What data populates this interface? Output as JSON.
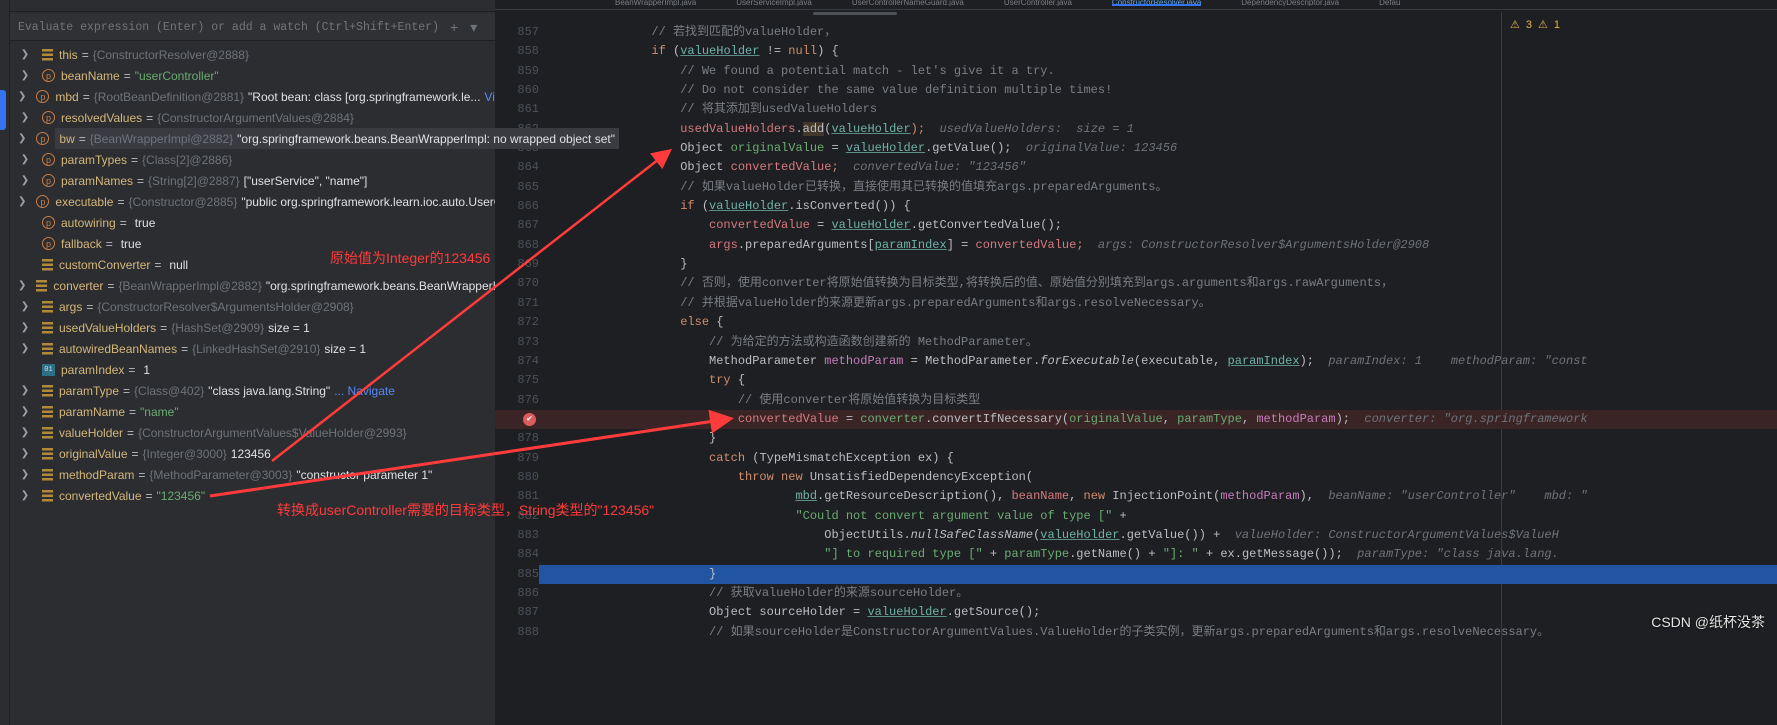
{
  "eval_bar": {
    "placeholder": "Evaluate expression (Enter) or add a watch (Ctrl+Shift+Enter) Java ▴",
    "add_watch_icon": "plus-icon",
    "dropdown_icon": "chevron-down-icon"
  },
  "variables": [
    {
      "arrow": true,
      "icon": "f",
      "name": "this",
      "type": "{ConstructorResolver@2888}"
    },
    {
      "arrow": true,
      "icon": "p",
      "name": "beanName",
      "str": "\"userController\""
    },
    {
      "arrow": true,
      "icon": "p",
      "name": "mbd",
      "type": "{RootBeanDefinition@2881}",
      "value": "\"Root bean: class [org.springframework.le...",
      "link": "View"
    },
    {
      "arrow": true,
      "icon": "p",
      "name": "resolvedValues",
      "type": "{ConstructorArgumentValues@2884}"
    },
    {
      "arrow": true,
      "icon": "p",
      "name": "bw",
      "type": "{BeanWrapperImpl@2882}",
      "value": "\"org.springframework.beans.BeanWrapperImpl: no wrapped object set\"",
      "tooltip": true
    },
    {
      "arrow": true,
      "icon": "p",
      "name": "paramTypes",
      "type": "{Class[2]@2886}"
    },
    {
      "arrow": true,
      "icon": "p",
      "name": "paramNames",
      "type": "{String[2]@2887}",
      "value": "[\"userService\", \"name\"]"
    },
    {
      "arrow": true,
      "icon": "p",
      "name": "executable",
      "type": "{Constructor@2885}",
      "value": "\"public org.springframework.learn.ioc.auto.UserCo"
    },
    {
      "arrow": false,
      "icon": "p",
      "name": "autowiring",
      "value": "true"
    },
    {
      "arrow": false,
      "icon": "p",
      "name": "fallback",
      "value": "true"
    },
    {
      "arrow": false,
      "icon": "f",
      "name": "customConverter",
      "value": "null"
    },
    {
      "arrow": true,
      "icon": "f",
      "name": "converter",
      "type": "{BeanWrapperImpl@2882}",
      "value": "\"org.springframework.beans.BeanWrapperIm"
    },
    {
      "arrow": true,
      "icon": "f",
      "name": "args",
      "type": "{ConstructorResolver$ArgumentsHolder@2908}"
    },
    {
      "arrow": true,
      "icon": "f",
      "name": "usedValueHolders",
      "type": "{HashSet@2909}",
      "value": " size = 1"
    },
    {
      "arrow": true,
      "icon": "f",
      "name": "autowiredBeanNames",
      "type": "{LinkedHashSet@2910}",
      "value": " size = 1"
    },
    {
      "arrow": false,
      "icon": "i",
      "name": "paramIndex",
      "value": "1"
    },
    {
      "arrow": true,
      "icon": "f",
      "name": "paramType",
      "type": "{Class@402}",
      "value": "\"class java.lang.String\"",
      "link": "... Navigate"
    },
    {
      "arrow": true,
      "icon": "f",
      "name": "paramName",
      "str": "\"name\""
    },
    {
      "arrow": true,
      "icon": "f",
      "name": "valueHolder",
      "type": "{ConstructorArgumentValues$ValueHolder@2993}"
    },
    {
      "arrow": true,
      "icon": "f",
      "name": "originalValue",
      "type": "{Integer@3000}",
      "value": "123456"
    },
    {
      "arrow": true,
      "icon": "f",
      "name": "methodParam",
      "type": "{MethodParameter@3003}",
      "value": "\"constructor parameter 1\""
    },
    {
      "arrow": true,
      "icon": "f",
      "name": "convertedValue",
      "str": "\"123456\""
    }
  ],
  "tabs": [
    {
      "label": "BeanWrapperImpl.java"
    },
    {
      "label": "UserServiceImpl.java"
    },
    {
      "label": "UserControllerNameGuard.java"
    },
    {
      "label": "UserController.java"
    },
    {
      "label": "ConstructorResolver.java",
      "active": true
    },
    {
      "label": "DependencyDescriptor.java"
    },
    {
      "label": "Defau"
    }
  ],
  "inspections": {
    "warnings": "3",
    "weak_warnings": "1"
  },
  "code": [
    {
      "n": "857",
      "t": [
        [
          "            // 若找到匹配的valueHolder，",
          "c"
        ]
      ]
    },
    {
      "n": "858",
      "t": [
        [
          "            ",
          ""
        ],
        [
          "if",
          "k"
        ],
        [
          " (",
          ""
        ],
        [
          "valueHolder",
          "u"
        ],
        [
          " != ",
          ""
        ],
        [
          "null",
          "k"
        ],
        [
          ") {",
          ""
        ]
      ]
    },
    {
      "n": "859",
      "t": [
        [
          "                // We found a potential match - let's give it a try.",
          "c"
        ]
      ]
    },
    {
      "n": "860",
      "t": [
        [
          "                // Do not consider the same value definition multiple times!",
          "c"
        ]
      ]
    },
    {
      "n": "861",
      "t": [
        [
          "                // 将其添加到usedValueHolders",
          "c"
        ]
      ]
    },
    {
      "n": "862",
      "t": [
        [
          "                ",
          ""
        ],
        [
          "usedValueHolders",
          "cv"
        ],
        [
          ".",
          ""
        ],
        [
          "add",
          "hl"
        ],
        [
          "(",
          ""
        ],
        [
          "valueHolder",
          "u"
        ],
        [
          ");",
          "k"
        ],
        [
          "  usedValueHolders:  size = 1",
          "h"
        ]
      ]
    },
    {
      "n": "863",
      "t": [
        [
          "                Object ",
          ""
        ],
        [
          "originalValue",
          "gv"
        ],
        [
          " = ",
          ""
        ],
        [
          "valueHolder",
          "u"
        ],
        [
          ".getValue();",
          ""
        ],
        [
          "  originalValue: 123456",
          "h"
        ]
      ]
    },
    {
      "n": "864",
      "t": [
        [
          "                Object ",
          ""
        ],
        [
          "convertedValue",
          "cv"
        ],
        [
          ";",
          "k"
        ],
        [
          "  convertedValue: \"123456\"",
          "h"
        ]
      ]
    },
    {
      "n": "865",
      "t": [
        [
          "                // 如果valueHolder已转换，直接使用其已转换的值填充args.preparedArguments。",
          "c"
        ]
      ]
    },
    {
      "n": "866",
      "t": [
        [
          "                ",
          ""
        ],
        [
          "if",
          "k"
        ],
        [
          " (",
          ""
        ],
        [
          "valueHolder",
          "u"
        ],
        [
          ".isConverted()) {",
          ""
        ]
      ]
    },
    {
      "n": "867",
      "t": [
        [
          "                    ",
          ""
        ],
        [
          "convertedValue",
          "cv"
        ],
        [
          " = ",
          ""
        ],
        [
          "valueHolder",
          "u"
        ],
        [
          ".getConvertedValue();",
          ""
        ]
      ]
    },
    {
      "n": "868",
      "t": [
        [
          "                    ",
          ""
        ],
        [
          "args",
          "cv"
        ],
        [
          ".preparedArguments[",
          ""
        ],
        [
          "paramIndex",
          "u"
        ],
        [
          "] = ",
          ""
        ],
        [
          "convertedValue",
          "cv"
        ],
        [
          ";",
          "k"
        ],
        [
          "  args: ConstructorResolver$ArgumentsHolder@2908",
          "h"
        ]
      ]
    },
    {
      "n": "869",
      "t": [
        [
          "                }",
          ""
        ]
      ]
    },
    {
      "n": "870",
      "t": [
        [
          "                // 否则，使用converter将原始值转换为目标类型,将转换后的值、原始值分别填充到args.arguments和args.rawArguments，",
          "c"
        ]
      ]
    },
    {
      "n": "871",
      "t": [
        [
          "                // 并根据valueHolder的来源更新args.preparedArguments和args.resolveNecessary。",
          "c"
        ]
      ]
    },
    {
      "n": "872",
      "t": [
        [
          "                ",
          ""
        ],
        [
          "else",
          "k"
        ],
        [
          " {",
          ""
        ]
      ]
    },
    {
      "n": "873",
      "t": [
        [
          "                    // 为给定的方法或构造函数创建新的 MethodParameter。",
          "c"
        ]
      ]
    },
    {
      "n": "874",
      "t": [
        [
          "                    MethodParameter ",
          ""
        ],
        [
          "methodParam",
          "m"
        ],
        [
          " = MethodParameter.",
          ""
        ],
        [
          "forExecutable",
          "it"
        ],
        [
          "(executable, ",
          ""
        ],
        [
          "paramIndex",
          "u"
        ],
        [
          ");",
          ""
        ],
        [
          "  paramIndex: 1    methodParam: \"const",
          "h"
        ]
      ]
    },
    {
      "n": "875",
      "t": [
        [
          "                    ",
          ""
        ],
        [
          "try",
          "k"
        ],
        [
          " {",
          ""
        ]
      ]
    },
    {
      "n": "876",
      "t": [
        [
          "                        // 使用converter将原始值转换为目标类型",
          "c"
        ]
      ]
    },
    {
      "n": "",
      "bp": true,
      "t": [
        [
          "                        ",
          ""
        ],
        [
          "convertedValue",
          "cv"
        ],
        [
          " = ",
          ""
        ],
        [
          "converter",
          "g"
        ],
        [
          ".convertIfNecessary(",
          ""
        ],
        [
          "originalValue",
          "g"
        ],
        [
          ", ",
          ""
        ],
        [
          "paramType",
          "g"
        ],
        [
          ", ",
          ""
        ],
        [
          "methodParam",
          "m"
        ],
        [
          ");",
          ""
        ],
        [
          "  converter: \"org.springframework",
          "h"
        ]
      ]
    },
    {
      "n": "878",
      "t": [
        [
          "                    }",
          ""
        ]
      ]
    },
    {
      "n": "879",
      "t": [
        [
          "                    ",
          ""
        ],
        [
          "catch",
          "k"
        ],
        [
          " (TypeMismatchException ex) {",
          ""
        ]
      ]
    },
    {
      "n": "880",
      "t": [
        [
          "                        ",
          ""
        ],
        [
          "throw new",
          "k"
        ],
        [
          " UnsatisfiedDependencyException(",
          ""
        ]
      ]
    },
    {
      "n": "881",
      "t": [
        [
          "                                ",
          ""
        ],
        [
          "mbd",
          "u"
        ],
        [
          ".getResourceDescription(), ",
          ""
        ],
        [
          "beanName",
          "cv"
        ],
        [
          ", ",
          ""
        ],
        [
          "new",
          "k"
        ],
        [
          " InjectionPoint(",
          ""
        ],
        [
          "methodParam",
          "m"
        ],
        [
          "),",
          ""
        ],
        [
          "  beanName: \"userController\"    mbd: \"",
          "h"
        ]
      ]
    },
    {
      "n": "882",
      "t": [
        [
          "                                ",
          ""
        ],
        [
          "\"Could not convert argument value of type [\"",
          "s"
        ],
        [
          " +",
          ""
        ]
      ]
    },
    {
      "n": "883",
      "t": [
        [
          "                                    ObjectUtils.",
          ""
        ],
        [
          "nullSafeClassName",
          "it"
        ],
        [
          "(",
          ""
        ],
        [
          "valueHolder",
          "u"
        ],
        [
          ".getValue()) +",
          ""
        ],
        [
          "  valueHolder: ConstructorArgumentValues$ValueH",
          "h"
        ]
      ]
    },
    {
      "n": "884",
      "t": [
        [
          "                                    ",
          ""
        ],
        [
          "\"] to required type [\"",
          "s"
        ],
        [
          " + ",
          ""
        ],
        [
          "paramType",
          "g"
        ],
        [
          ".getName() + ",
          ""
        ],
        [
          "\"]: \"",
          "s"
        ],
        [
          " + ex.getMessage());",
          ""
        ],
        [
          "  paramType: \"class java.lang.",
          "h"
        ]
      ]
    },
    {
      "n": "885",
      "sel": true,
      "t": [
        [
          "                    }",
          ""
        ]
      ]
    },
    {
      "n": "886",
      "t": [
        [
          "                    // 获取valueHolder的来源sourceHolder。",
          "c"
        ]
      ]
    },
    {
      "n": "887",
      "t": [
        [
          "                    Object sourceHolder = ",
          ""
        ],
        [
          "valueHolder",
          "u"
        ],
        [
          ".getSource();",
          ""
        ]
      ]
    },
    {
      "n": "888",
      "t": [
        [
          "                    // 如果sourceHolder是ConstructorArgumentValues.ValueHolder的子类实例，更新args.preparedArguments和args.resolveNecessary。",
          "c"
        ]
      ]
    }
  ],
  "annotations": {
    "original": "原始值为Integer的123456",
    "converted": "转换成userController需要的目标类型，String类型的\"123456\"",
    "color": "#ff3b3b"
  },
  "watermark": "CSDN @纸杯没茶"
}
